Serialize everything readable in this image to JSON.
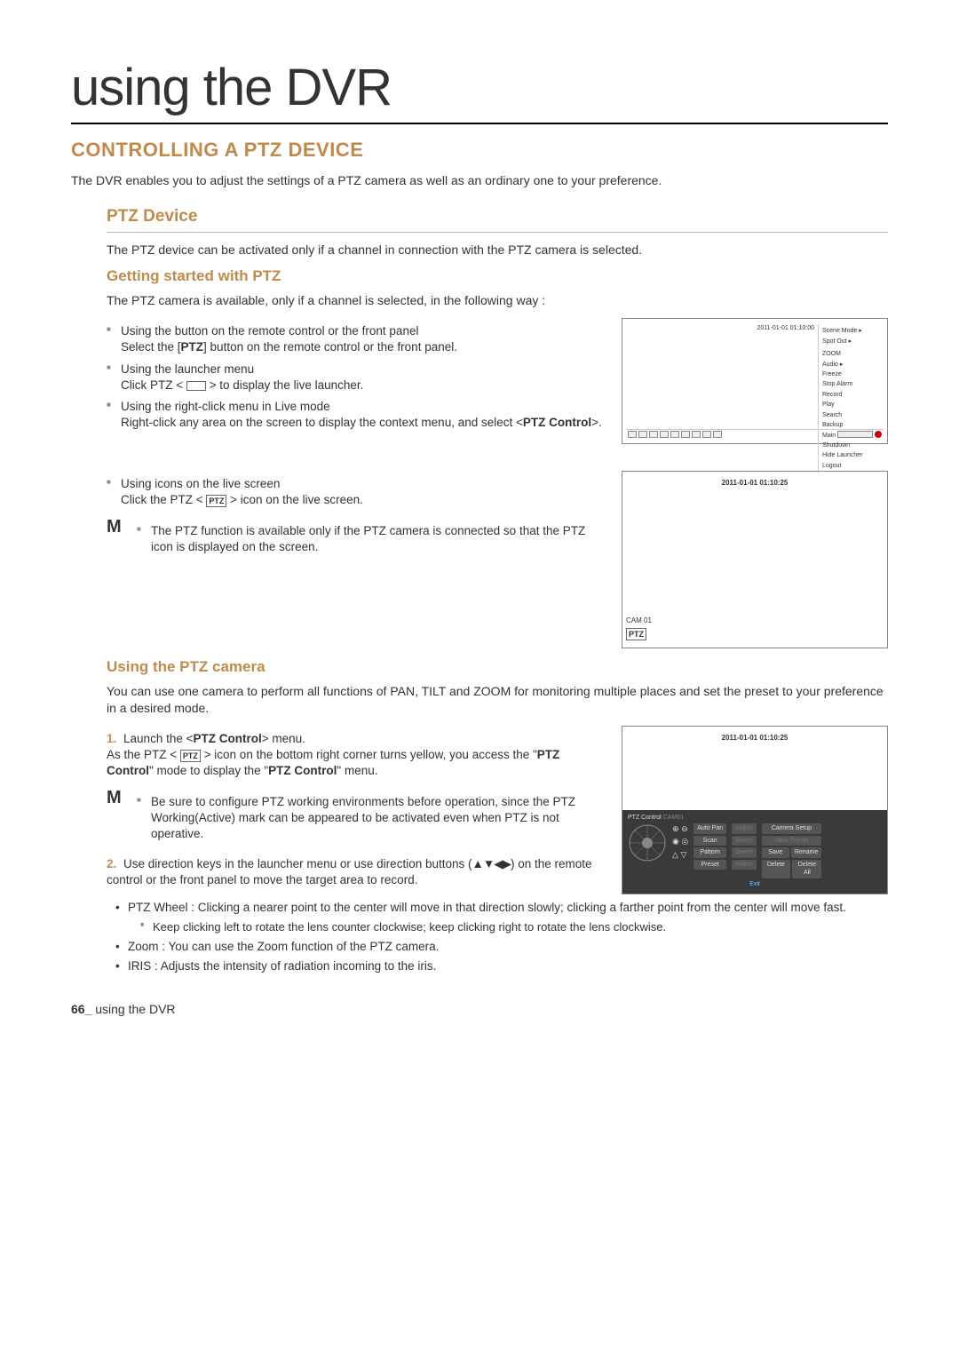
{
  "page": {
    "title": "using the DVR",
    "section_head": "CONTROLLING A PTZ DEVICE",
    "intro": "The DVR enables you to adjust the settings of a PTZ camera as well as an ordinary one to your preference.",
    "sub_head": "PTZ Device",
    "sub_intro": "The PTZ device can be activated only if a channel in connection with the PTZ camera is selected.",
    "sub_sub_head_1": "Getting started with PTZ",
    "sub_sub_intro_1": "The PTZ camera is available, only if a channel is selected, in the following way :",
    "bullets1": [
      {
        "title": "Using the button on the remote control or the front panel",
        "desc_pre": "Select the [",
        "desc_bold": "PTZ",
        "desc_post": "] button on the remote control or the front panel."
      },
      {
        "title": "Using the launcher menu",
        "desc_pre": "Click PTZ < ",
        "desc_post": " > to display the live launcher."
      },
      {
        "title": "Using the right-click menu in Live mode",
        "desc_pre": "Right-click any area on the screen to display the context menu, and select <",
        "desc_bold": "PTZ Control",
        "desc_post": ">."
      }
    ],
    "bullets2": [
      {
        "title": "Using icons on the live screen",
        "desc_pre": "Click the PTZ < ",
        "desc_post": " > icon on the live screen."
      }
    ],
    "note1": "The PTZ function is available only if the PTZ camera is connected so that the PTZ icon is displayed on the screen.",
    "note_mark": "M",
    "sub_sub_head_2": "Using the PTZ camera",
    "using_intro": "You can use one camera to perform all functions of PAN, TILT and ZOOM for monitoring multiple places and set the preset to your preference in a desired mode.",
    "step1_num": "1.",
    "step1_a": "Launch the <",
    "step1_b": "PTZ Control",
    "step1_c": "> menu.",
    "step1_d_pre": "As the PTZ < ",
    "step1_d_post": " > icon on the bottom right corner turns yellow, you access the \"",
    "step1_e": "PTZ Control",
    "step1_f": "\" mode to display the \"",
    "step1_g": "PTZ Control",
    "step1_h": "\" menu.",
    "note2": "Be sure to configure PTZ working environments before operation, since the PTZ Working(Active) mark can be appeared to be activated even when PTZ is not operative.",
    "step2_num": "2.",
    "step2_pre": "Use direction keys in the launcher menu or use direction buttons (",
    "step2_dirs": "▲▼◀▶",
    "step2_post": ") on the remote control or the front panel to move the target area to record.",
    "bul2": [
      "PTZ Wheel : Clicking a nearer point to the center will move in that direction slowly; clicking a farther point from the center will move fast.",
      "Zoom : You can use the Zoom function of the PTZ camera.",
      "IRIS : Adjusts the intensity of radiation incoming to the iris."
    ],
    "bul2_sub": "Keep clicking left to rotate the lens counter clockwise; keep clicking right to rotate the lens clockwise.",
    "footer_num": "66_",
    "footer_text": " using the DVR"
  },
  "fig1": {
    "timestamp": "2011-01-01 01:10:00",
    "menu": [
      "Scene Mode  ▸",
      "Spot Out  ▸",
      "ZOOM",
      "Audio  ▸",
      "Freeze",
      "Stop Alarm",
      "Record",
      "Play",
      "Search",
      "Backup",
      "Main Menu",
      "Shutdown",
      "Hide Launcher",
      "Logout"
    ]
  },
  "fig2": {
    "timestamp": "2011-01-01 01:10:25",
    "cam": "CAM 01",
    "ptz": "PTZ"
  },
  "fig3": {
    "timestamp": "2011-01-01 01:10:25",
    "panel_title": "PTZ Control",
    "cam_label": "CAM01",
    "col1": [
      "Auto Pan",
      "Scan",
      "Pattern",
      "Preset"
    ],
    "col2": [
      "Select",
      "Select",
      "Select",
      "Select"
    ],
    "col3_top": "Camera Setup",
    "col3_mid": "Save Preset",
    "col3_save": "Save",
    "col3_rename": "Rename",
    "col3_delete": "Delete",
    "col3_deleteall": "Delete All",
    "exit": "Exit"
  },
  "ptz_icon_label": "PTZ"
}
